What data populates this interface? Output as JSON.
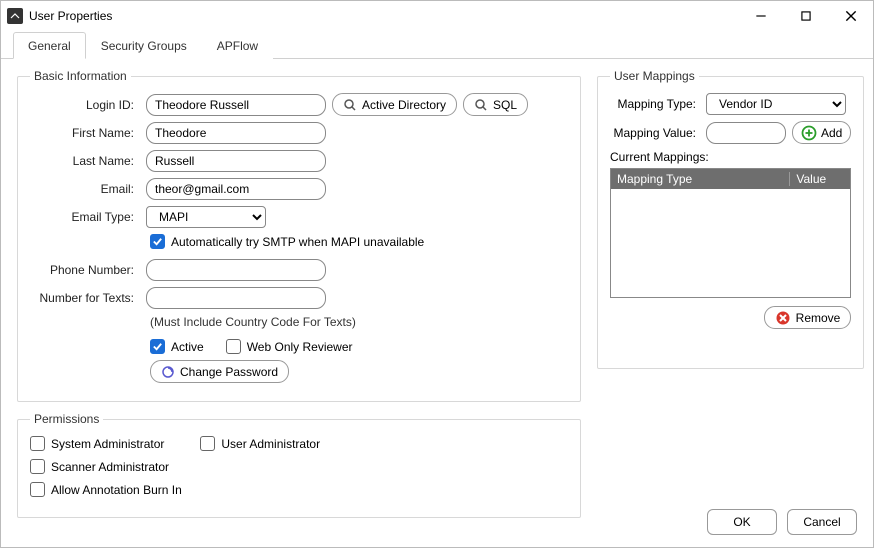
{
  "window": {
    "title": "User Properties"
  },
  "tabs": {
    "general": "General",
    "security": "Security Groups",
    "apflow": "APFlow"
  },
  "basic": {
    "legend": "Basic Information",
    "labels": {
      "login": "Login ID:",
      "first": "First Name:",
      "last": "Last Name:",
      "email": "Email:",
      "emailType": "Email Type:",
      "phone": "Phone Number:",
      "texts": "Number for Texts:"
    },
    "values": {
      "login": "Theodore Russell",
      "first": "Theodore",
      "last": "Russell",
      "email": "theor@gmail.com",
      "emailType": "MAPI",
      "phone": "",
      "texts": ""
    },
    "buttons": {
      "ad": "Active Directory",
      "sql": "SQL",
      "changePw": "Change Password"
    },
    "smtpFallback": "Automatically try SMTP when MAPI unavailable",
    "textsNote": "(Must Include Country Code For Texts)",
    "active": "Active",
    "webOnly": "Web Only Reviewer"
  },
  "perm": {
    "legend": "Permissions",
    "sysAdmin": "System Administrator",
    "userAdmin": "User Administrator",
    "scanAdmin": "Scanner Administrator",
    "burnIn": "Allow Annotation Burn In"
  },
  "map": {
    "legend": "User Mappings",
    "typeLabel": "Mapping Type:",
    "typeValue": "Vendor ID",
    "valueLabel": "Mapping Value:",
    "valueValue": "",
    "addLabel": "Add",
    "currentLabel": "Current Mappings:",
    "col1": "Mapping Type",
    "col2": "Value",
    "removeLabel": "Remove"
  },
  "footer": {
    "ok": "OK",
    "cancel": "Cancel"
  }
}
